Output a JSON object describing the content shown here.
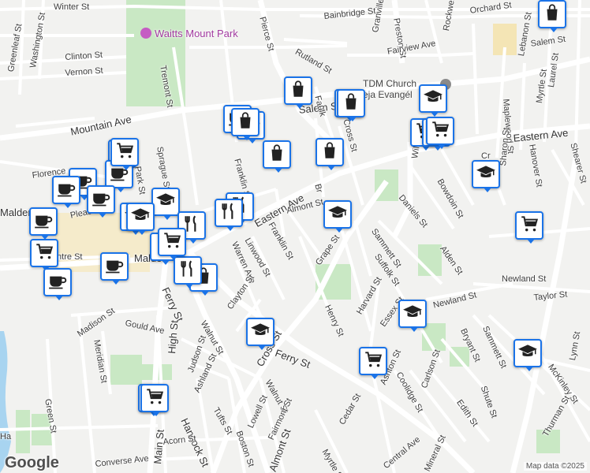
{
  "attribution": "Map data ©2025",
  "google_logo": "Google",
  "colors": {
    "poi_border": "#1a73e8",
    "park": "#c9e8c4",
    "water": "#a8d4f0",
    "road": "#ffffff",
    "major_road": "#fdfdfd"
  },
  "park_label": "Waitts Mount Park",
  "church_label": [
    "TDM Church",
    "eja Evangél"
  ],
  "streets": [
    "Winter St",
    "Bainbridge St",
    "Rockwell St",
    "Orchard St",
    "Lebanon St",
    "Salem St",
    "Waitts Mount Park",
    "Pierce St",
    "Preston St",
    "Granville Ave",
    "Fairview Ave",
    "Rutland St",
    "Greenleaf St",
    "Washington St",
    "Clinton St",
    "Vernon St",
    "Tremont St",
    "Mountain Ave",
    "Cross St",
    "Salem St",
    "Faulk",
    "Myrtle St",
    "Laurel St",
    "Maplewood St",
    "Sharon St",
    "Hanover St",
    "Shearer St",
    "Eastern Ave",
    "Cr",
    "Florence",
    "Park St",
    "Sprague St",
    "Franklin St",
    "Willow St",
    "Bowdoin St",
    "Daniels St",
    "Malden",
    "Pleasant St",
    "Eastern Ave",
    "Almont St",
    "Br",
    "Centre St",
    "Malden",
    "Linwood St",
    "Franklin St",
    "Warren Ave",
    "Grape St",
    "Sammett St",
    "Alden St",
    "Suffolk St",
    "Newland St",
    "Taylor St",
    "Clayton St",
    "Ferry St",
    "Henry St",
    "Harvard St",
    "Essex St",
    "Newland St",
    "Madison St",
    "Gould Ave",
    "Walnut St",
    "Cross St",
    "Bryant St",
    "Sammett St",
    "Lynn St",
    "Meridian St",
    "High St",
    "Judson St",
    "Ferry St",
    "Ashton St",
    "Coolidge St",
    "Carlson St",
    "McKinley St",
    "Ashland St",
    "Walnut St",
    "Shute St",
    "Edith St",
    "Thurman St",
    "Green St",
    "Tufts St",
    "Lowell St",
    "Hancock St",
    "Fairmont St",
    "Cedar St",
    "Main St",
    "Acorn St",
    "Boston St",
    "Converse Ave",
    "Almont St",
    "Myrtle St",
    "Central Ave",
    "Mineral St",
    "Ha"
  ],
  "poi_icons": [
    "shopping-bag",
    "shopping-bag",
    "shopping-bag",
    "school",
    "cart",
    "cafe",
    "cafe",
    "cart",
    "cafe",
    "school",
    "cafe",
    "cafe",
    "cart",
    "school",
    "restaurant",
    "restaurant",
    "school",
    "cart",
    "cafe",
    "restaurant",
    "shopping-bag",
    "cafe",
    "cart",
    "cafe",
    "shopping-bag",
    "restaurant",
    "shopping-bag",
    "school",
    "cart",
    "school",
    "shopping-bag",
    "cart",
    "school",
    "cart",
    "school",
    "cafe",
    "cart",
    "school",
    "shopping-bag",
    "shopping-bag",
    "cart",
    "cart"
  ]
}
